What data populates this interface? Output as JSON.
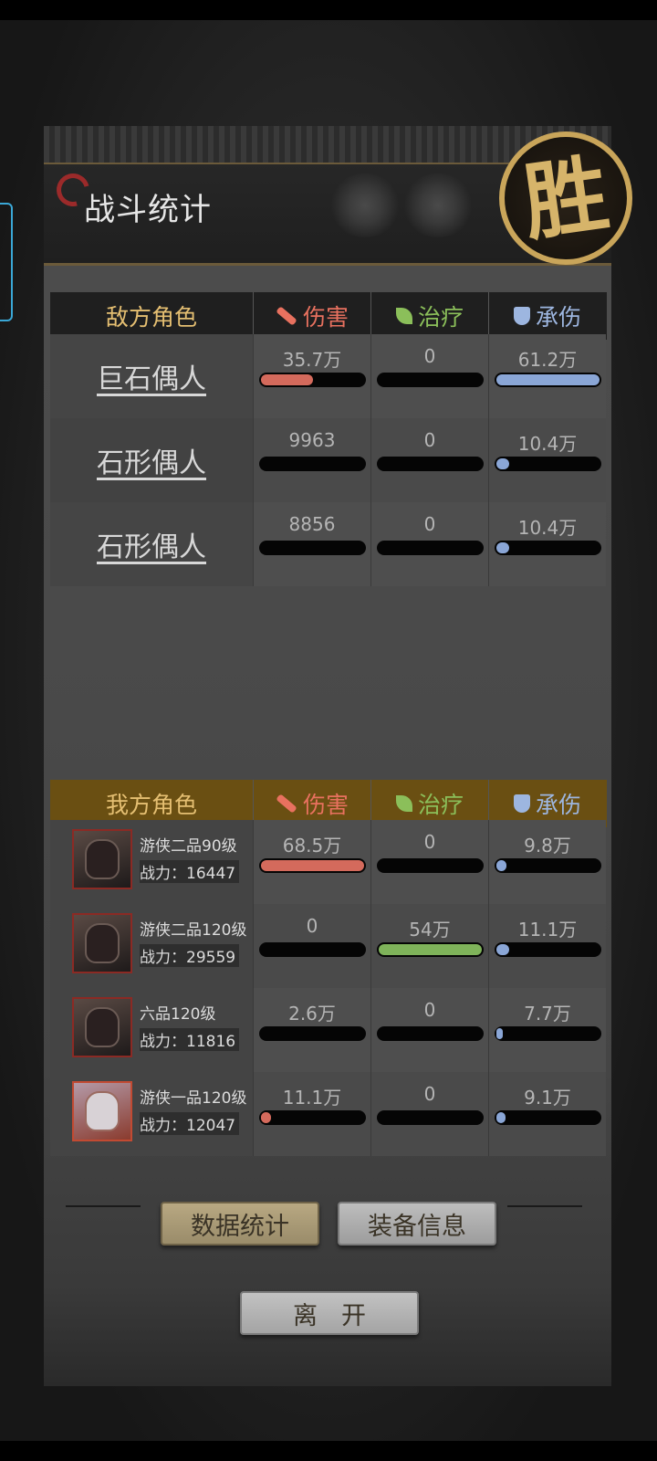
{
  "header": {
    "title": "战斗统计",
    "result_badge": "胜"
  },
  "columns": {
    "damage": "伤害",
    "heal": "治疗",
    "tank": "承伤"
  },
  "enemy": {
    "header": "敌方角色",
    "rows": [
      {
        "name": "巨石偶人",
        "damage": "35.7万",
        "damage_pct": 50,
        "heal": "0",
        "heal_pct": 0,
        "tank": "61.2万",
        "tank_pct": 100
      },
      {
        "name": "石形偶人",
        "damage": "9963",
        "damage_pct": 0,
        "heal": "0",
        "heal_pct": 0,
        "tank": "10.4万",
        "tank_pct": 12
      },
      {
        "name": "石形偶人",
        "damage": "8856",
        "damage_pct": 0,
        "heal": "0",
        "heal_pct": 0,
        "tank": "10.4万",
        "tank_pct": 12
      }
    ]
  },
  "ally": {
    "header": "我方角色",
    "rows": [
      {
        "title": "游侠二品90级",
        "power": "战力：16447",
        "damage": "68.5万",
        "damage_pct": 100,
        "heal": "0",
        "heal_pct": 0,
        "tank": "9.8万",
        "tank_pct": 10
      },
      {
        "title": "游侠二品120级",
        "power": "战力：29559",
        "damage": "0",
        "damage_pct": 0,
        "heal": "54万",
        "heal_pct": 100,
        "tank": "11.1万",
        "tank_pct": 12
      },
      {
        "title": "六品120级",
        "power": "战力：11816",
        "damage": "2.6万",
        "damage_pct": 0,
        "heal": "0",
        "heal_pct": 0,
        "tank": "7.7万",
        "tank_pct": 6
      },
      {
        "title": "游侠一品120级",
        "power": "战力：12047",
        "damage": "11.1万",
        "damage_pct": 10,
        "heal": "0",
        "heal_pct": 0,
        "tank": "9.1万",
        "tank_pct": 9
      }
    ]
  },
  "buttons": {
    "stats": "数据统计",
    "equip": "装备信息",
    "leave": "离开"
  },
  "colors": {
    "damage": "#d46a5c",
    "heal": "#7fb35a",
    "tank": "#8aa6d6",
    "gold": "#c9a55a"
  }
}
